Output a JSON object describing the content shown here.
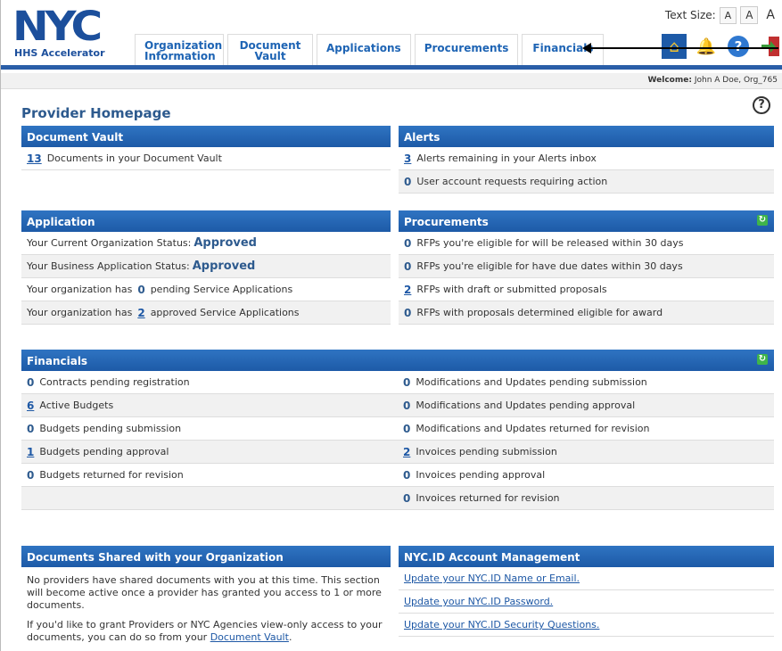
{
  "header": {
    "logo_text": "NYC",
    "logo_sub": "HHS Accelerator",
    "nav": [
      "Organization Information",
      "Document Vault",
      "Applications",
      "Procurements",
      "Financials"
    ],
    "text_size_label": "Text Size:",
    "text_size_options": [
      "A",
      "A",
      "A"
    ],
    "welcome_label": "Welcome:",
    "welcome_user": "John A Doe, Org_765"
  },
  "page": {
    "title": "Provider Homepage"
  },
  "document_vault": {
    "title": "Document Vault",
    "count": "13",
    "text": "Documents in your Document Vault"
  },
  "alerts": {
    "title": "Alerts",
    "rows": [
      {
        "num": "3",
        "text": "Alerts remaining in your Alerts inbox"
      },
      {
        "num": "0",
        "text": "User account requests requiring action"
      }
    ]
  },
  "application": {
    "title": "Application",
    "org_status_label": "Your Current Organization Status:",
    "org_status": "Approved",
    "biz_status_label": "Your Business Application Status:",
    "biz_status": "Approved",
    "pending_prefix": "Your organization has",
    "pending_num": "0",
    "pending_suffix": "pending Service Applications",
    "approved_prefix": "Your organization has",
    "approved_num": "2",
    "approved_suffix": "approved Service Applications"
  },
  "procurements": {
    "title": "Procurements",
    "rows": [
      {
        "num": "0",
        "text": "RFPs you're eligible for will be released within 30 days"
      },
      {
        "num": "0",
        "text": "RFPs you're eligible for have due dates within 30 days"
      },
      {
        "num": "2",
        "text": "RFPs with draft or submitted proposals"
      },
      {
        "num": "0",
        "text": "RFPs with proposals determined eligible for award"
      }
    ]
  },
  "financials": {
    "title": "Financials",
    "left": [
      {
        "num": "0",
        "text": "Contracts pending registration"
      },
      {
        "num": "6",
        "text": "Active Budgets"
      },
      {
        "num": "0",
        "text": "Budgets pending submission"
      },
      {
        "num": "1",
        "text": "Budgets pending approval"
      },
      {
        "num": "0",
        "text": "Budgets returned for revision"
      }
    ],
    "right": [
      {
        "num": "0",
        "text": "Modifications and Updates pending submission"
      },
      {
        "num": "0",
        "text": "Modifications and Updates pending approval"
      },
      {
        "num": "0",
        "text": "Modifications and Updates returned for revision"
      },
      {
        "num": "2",
        "text": "Invoices pending submission"
      },
      {
        "num": "0",
        "text": "Invoices pending approval"
      },
      {
        "num": "0",
        "text": "Invoices returned for revision"
      }
    ]
  },
  "shared_docs": {
    "title": "Documents Shared with your Organization",
    "para1": "No providers have shared documents with you at this time. This section will become active once a provider has granted you access to 1 or more documents.",
    "para2_prefix": "If you'd like to grant Providers or NYC Agencies view-only access to your documents, you can do so from your",
    "para2_link": "Document Vault",
    "para2_suffix": "."
  },
  "nycid": {
    "title": "NYC.ID Account Management",
    "links": [
      "Update your NYC.ID Name or Email.",
      "Update your NYC.ID Password.",
      "Update your NYC.ID Security Questions."
    ]
  }
}
